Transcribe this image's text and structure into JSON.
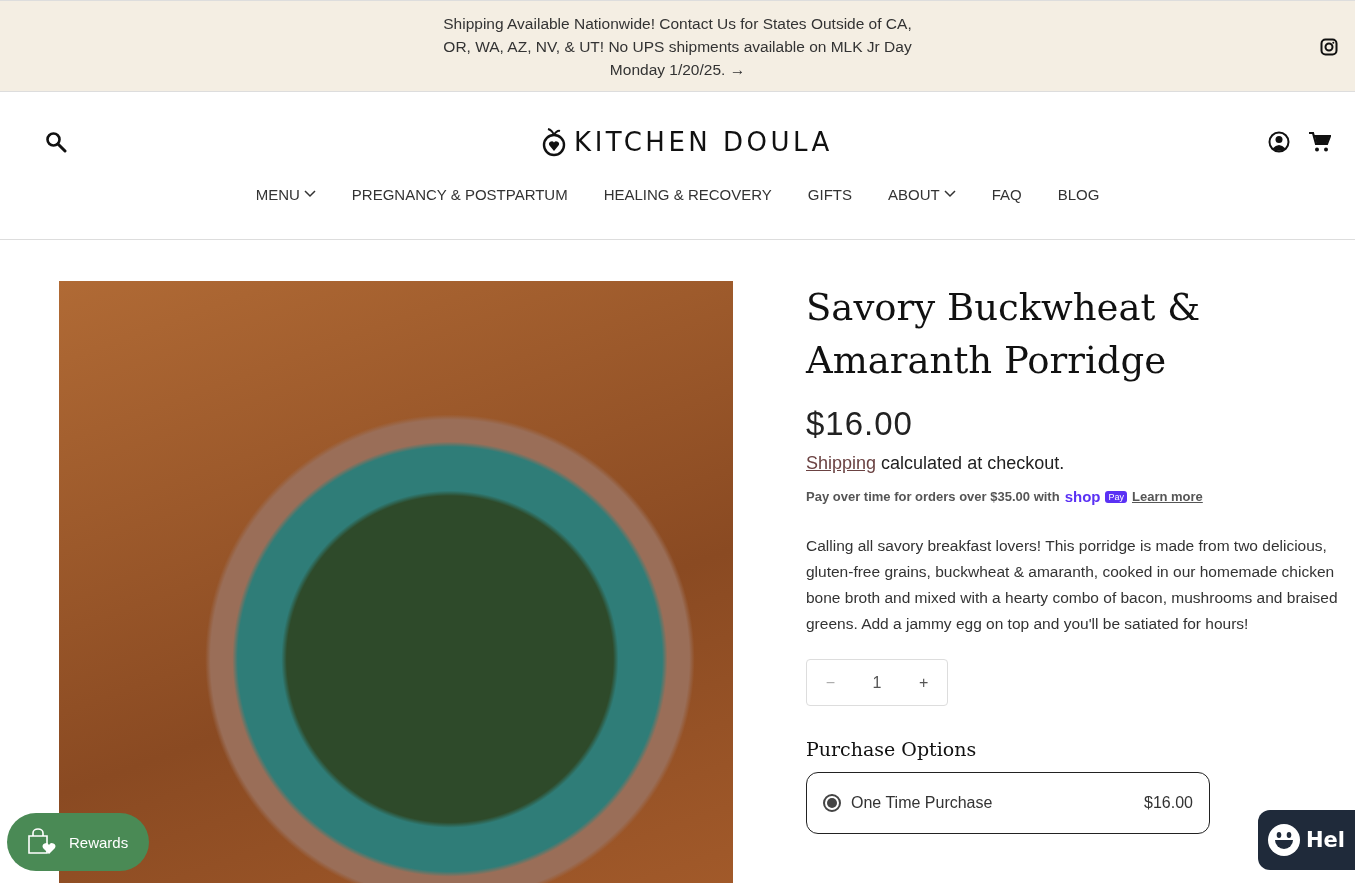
{
  "announcement": {
    "text": "Shipping Available Nationwide! Contact Us for States Outside of CA, OR, WA, AZ, NV, & UT! No UPS shipments available on MLK Jr Day Monday 1/20/25.",
    "arrow": "→"
  },
  "header": {
    "logo": "KITCHEN DOULA"
  },
  "nav": [
    {
      "label": "MENU",
      "has_dropdown": true
    },
    {
      "label": "PREGNANCY & POSTPARTUM",
      "has_dropdown": false
    },
    {
      "label": "HEALING & RECOVERY",
      "has_dropdown": false
    },
    {
      "label": "GIFTS",
      "has_dropdown": false
    },
    {
      "label": "ABOUT",
      "has_dropdown": true
    },
    {
      "label": "FAQ",
      "has_dropdown": false
    },
    {
      "label": "BLOG",
      "has_dropdown": false
    }
  ],
  "product": {
    "title": "Savory Buckwheat & Amaranth Porridge",
    "price": "$16.00",
    "shipping_link": "Shipping",
    "shipping_rest": "calculated at checkout.",
    "installments": {
      "text": "Pay over time for orders over **$35.00** with",
      "brand": "shop",
      "badge": "Pay",
      "link": "Learn more"
    },
    "description": "Calling all savory breakfast lovers! This porridge is made from two delicious, gluten-free grains, buckwheat & amaranth, cooked in our homemade chicken bone broth and mixed with a hearty combo of bacon, mushrooms and braised greens. Add a jammy egg on top and you'll be satiated for hours!",
    "quantity": {
      "minus": "−",
      "value": "1",
      "plus": "+"
    },
    "purchase_options": {
      "heading": "Purchase Options",
      "options": [
        {
          "label": "One Time Purchase",
          "price": "$16.00",
          "selected": true
        }
      ]
    }
  },
  "rewards_button": {
    "label": "Rewards"
  },
  "help_button": {
    "label": "Hel"
  }
}
